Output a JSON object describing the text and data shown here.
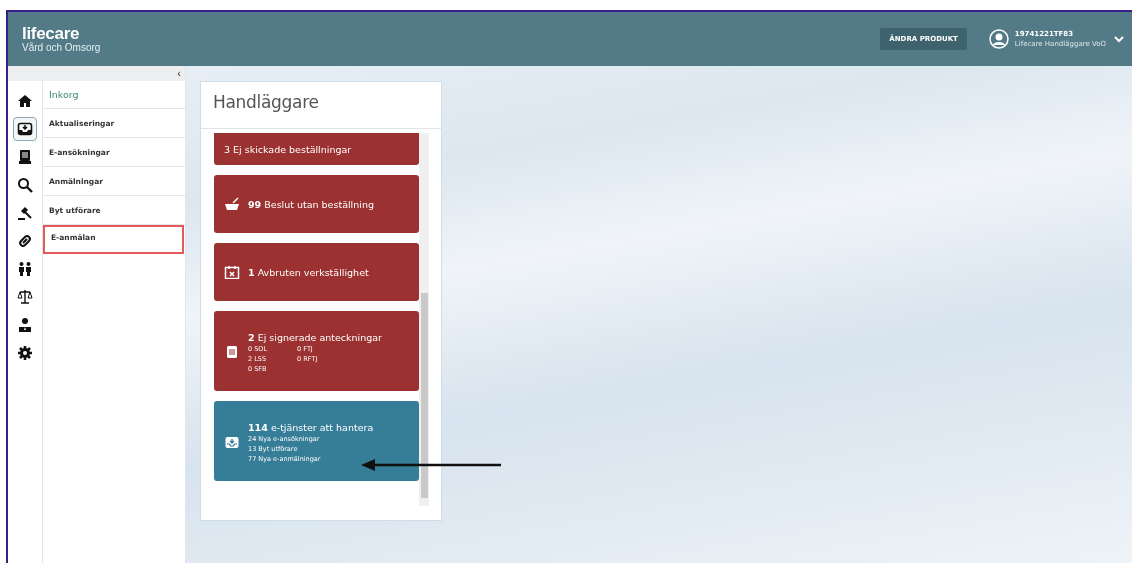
{
  "header": {
    "logo": "lifecare",
    "subtitle": "Vård och Omsorg",
    "product_button": "ÄNDRA PRODUKT",
    "user_id": "19741221TF83",
    "user_role": "Lifecare Handläggare VoO"
  },
  "sidebar": {
    "collapse": "‹",
    "icons": [
      {
        "kind": "home",
        "selected": false
      },
      {
        "kind": "inbox",
        "selected": true
      },
      {
        "kind": "document",
        "selected": false
      },
      {
        "kind": "search",
        "selected": false
      },
      {
        "kind": "gavel",
        "selected": false
      },
      {
        "kind": "link",
        "selected": false
      },
      {
        "kind": "people",
        "selected": false
      },
      {
        "kind": "scales",
        "selected": false
      },
      {
        "kind": "person",
        "selected": false
      },
      {
        "kind": "gear",
        "selected": false
      }
    ],
    "heading": "Inkorg",
    "items": [
      {
        "label": "Aktualiseringar",
        "selected": false
      },
      {
        "label": "E-ansökningar",
        "selected": false
      },
      {
        "label": "Anmälningar",
        "selected": false
      },
      {
        "label": "Byt utförare",
        "selected": false
      },
      {
        "label": "E-anmälan",
        "selected": true
      }
    ]
  },
  "panel": {
    "title": "Handläggare",
    "cards": [
      {
        "kind": "plain",
        "color": "#9b3131",
        "title": "3 Ej skickade beställningar"
      },
      {
        "kind": "basket",
        "color": "#9b3131",
        "count": "99",
        "title": "Beslut utan beställning"
      },
      {
        "kind": "calendar",
        "color": "#9b3131",
        "count": "1",
        "title": "Avbruten verkställighet"
      },
      {
        "kind": "notes",
        "color": "#9b3131",
        "count": "2",
        "title": "Ej signerade anteckningar",
        "details": [
          "0 SOL",
          "0 FTJ",
          "2 LSS",
          "0 RFTJ",
          "0 SFB"
        ]
      },
      {
        "kind": "inbox",
        "color": "#367d97",
        "count": "114",
        "title": "e-tjänster att hantera",
        "details": [
          "24 Nya e-ansökningar",
          "13 Byt utförare",
          "77 Nya e-anmälningar"
        ]
      }
    ]
  }
}
